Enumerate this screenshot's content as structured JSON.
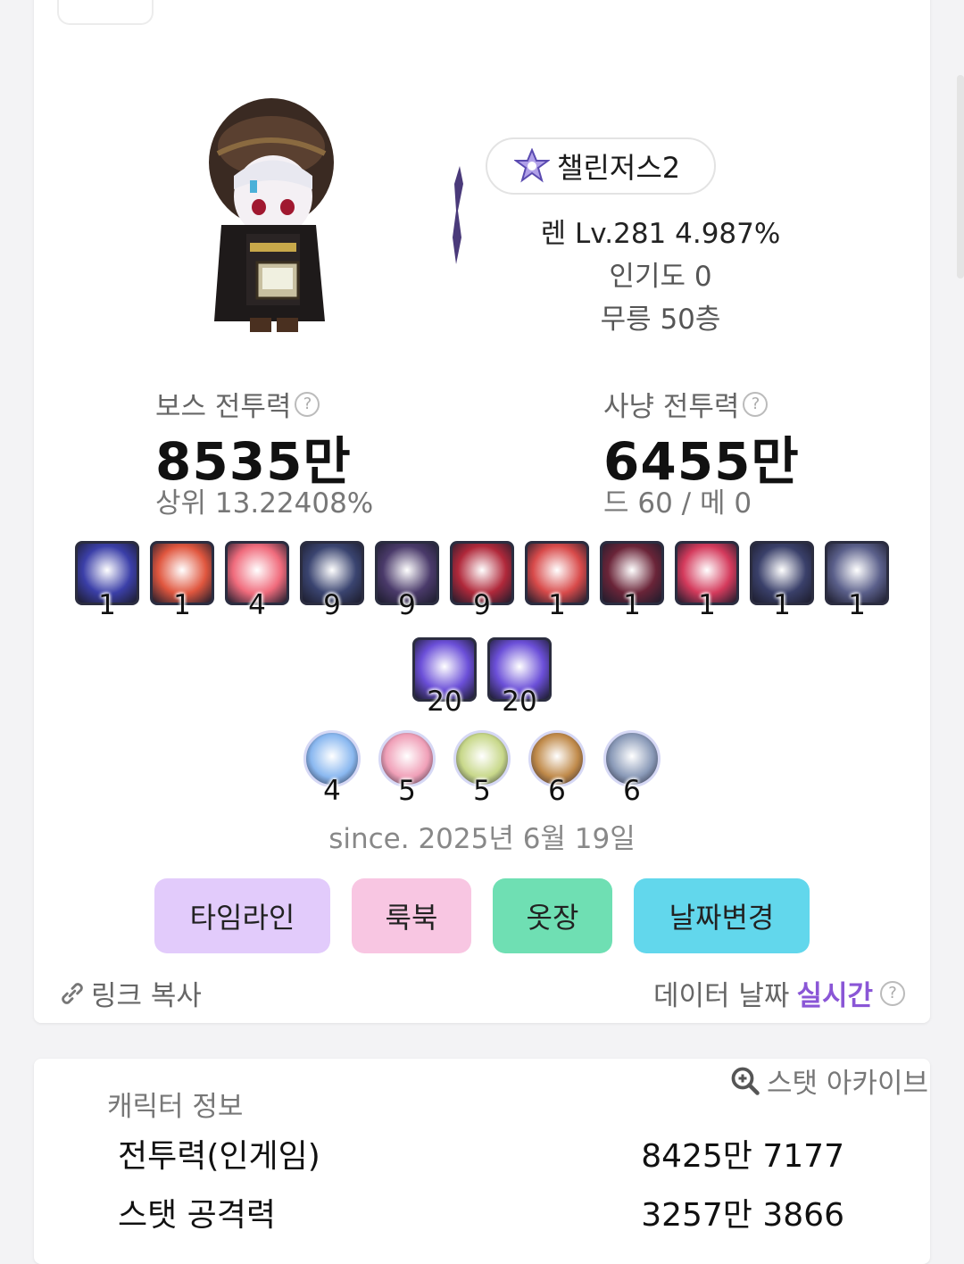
{
  "character": {
    "guild_name": "챌린저스2",
    "level_line": "렌 Lv.281 4.987%",
    "popularity": "인기도 0",
    "mureung": "무릉 50층"
  },
  "boss_power": {
    "label": "보스 전투력",
    "value": "8535만",
    "sub": "상위 13.22408%"
  },
  "hunt_power": {
    "label": "사냥 전투력",
    "value": "6455만",
    "sub": "드 60 / 메 0"
  },
  "skills_row1": [
    {
      "level": "1",
      "color": "#3b3fa8"
    },
    {
      "level": "1",
      "color": "#e0563e"
    },
    {
      "level": "4",
      "color": "#f06b7c"
    },
    {
      "level": "9",
      "color": "#3a4470"
    },
    {
      "level": "9",
      "color": "#4a3a6a"
    },
    {
      "level": "9",
      "color": "#b0283a"
    },
    {
      "level": "1",
      "color": "#d84a4a"
    },
    {
      "level": "1",
      "color": "#6a2438"
    },
    {
      "level": "1",
      "color": "#d43a5c"
    },
    {
      "level": "1",
      "color": "#3a406a"
    },
    {
      "level": "1",
      "color": "#5a5f8a"
    }
  ],
  "skills_row2": [
    {
      "level": "20",
      "color": "#6b4fd8"
    },
    {
      "level": "20",
      "color": "#6b4fd8"
    }
  ],
  "symbols": [
    {
      "level": "4",
      "color": "#8ab8f0"
    },
    {
      "level": "5",
      "color": "#f0a0b8"
    },
    {
      "level": "5",
      "color": "#c8d88a"
    },
    {
      "level": "6",
      "color": "#c08a4a"
    },
    {
      "level": "6",
      "color": "#8a9ab8"
    }
  ],
  "since": "since. 2025년 6월 19일",
  "buttons": {
    "timeline": "타임라인",
    "lookbook": "룩북",
    "closet": "옷장",
    "date_change": "날짜변경"
  },
  "link_copy": "링크 복사",
  "data_date_label": "데이터 날짜",
  "data_date_value": "실시간",
  "stat_archive": "스탯 아카이브",
  "info": {
    "title": "캐릭터 정보",
    "rows": [
      {
        "label": "전투력(인게임)",
        "value": "8425만 7177"
      },
      {
        "label": "스탯 공격력",
        "value": "3257만 3866"
      }
    ]
  }
}
